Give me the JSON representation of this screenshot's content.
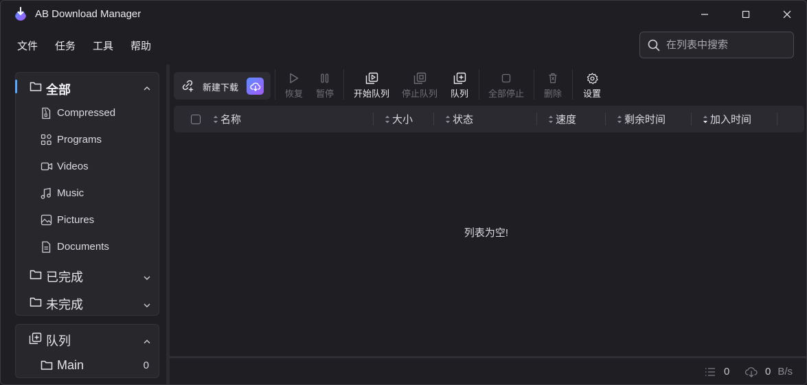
{
  "window": {
    "title": "AB Download Manager",
    "accent_color": "#5aa7ff",
    "logo_gradient": [
      "#5b8dff",
      "#a35bff"
    ]
  },
  "menu": {
    "items": [
      "文件",
      "任务",
      "工具",
      "帮助"
    ]
  },
  "search": {
    "placeholder": "在列表中搜索",
    "value": ""
  },
  "sidebar": {
    "categories": {
      "title": "全部",
      "items": [
        {
          "label": "Compressed",
          "icon": "zip-file-icon"
        },
        {
          "label": "Programs",
          "icon": "apps-grid-icon"
        },
        {
          "label": "Videos",
          "icon": "video-camera-icon"
        },
        {
          "label": "Music",
          "icon": "music-note-icon"
        },
        {
          "label": "Pictures",
          "icon": "image-icon"
        },
        {
          "label": "Documents",
          "icon": "document-icon"
        }
      ],
      "completed": "已完成",
      "unfinished": "未完成"
    },
    "queues": {
      "title": "队列",
      "items": [
        {
          "label": "Main",
          "count": "0"
        }
      ]
    }
  },
  "toolbar": {
    "new_download": "新建下载",
    "resume": "恢复",
    "pause": "暂停",
    "start_queue": "开始队列",
    "stop_queue": "停止队列",
    "queue": "队列",
    "stop_all": "全部停止",
    "delete": "删除",
    "settings": "设置"
  },
  "table": {
    "columns": [
      "名称",
      "大小",
      "状态",
      "速度",
      "剩余时间",
      "加入时间"
    ],
    "empty_message": "列表为空!"
  },
  "status_bar": {
    "active_count": "0",
    "speed_value": "0",
    "speed_unit": "B/s"
  }
}
